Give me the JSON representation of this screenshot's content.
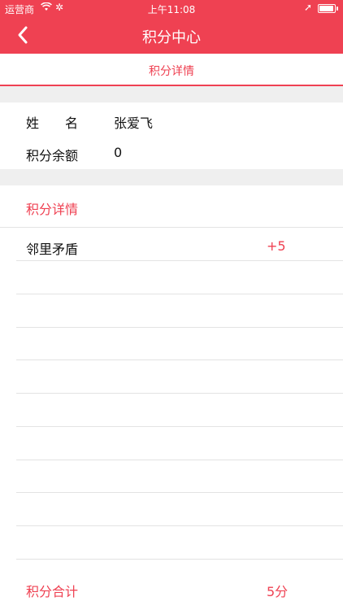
{
  "status_bar": {
    "carrier": "运营商",
    "wifi_icon": "wifi-icon",
    "activity_icon": "activity-icon",
    "time": "上午11:08",
    "location_icon": "location-arrow-icon",
    "battery_icon": "battery-icon",
    "battery_level": 0.95
  },
  "nav": {
    "title": "积分中心",
    "back_icon": "chevron-left-icon"
  },
  "tab": {
    "label": "积分详情"
  },
  "profile": {
    "name_label": "姓　　名",
    "name_value": "张爱飞",
    "balance_label": "积分余额",
    "balance_value": "0"
  },
  "details": {
    "title": "积分详情",
    "items": [
      {
        "name": "邻里矛盾",
        "points": "+5"
      }
    ]
  },
  "total": {
    "label": "积分合计",
    "value": "5分"
  },
  "colors": {
    "accent": "#ef4152",
    "band": "#efefef",
    "separator": "#e3e3e3"
  }
}
